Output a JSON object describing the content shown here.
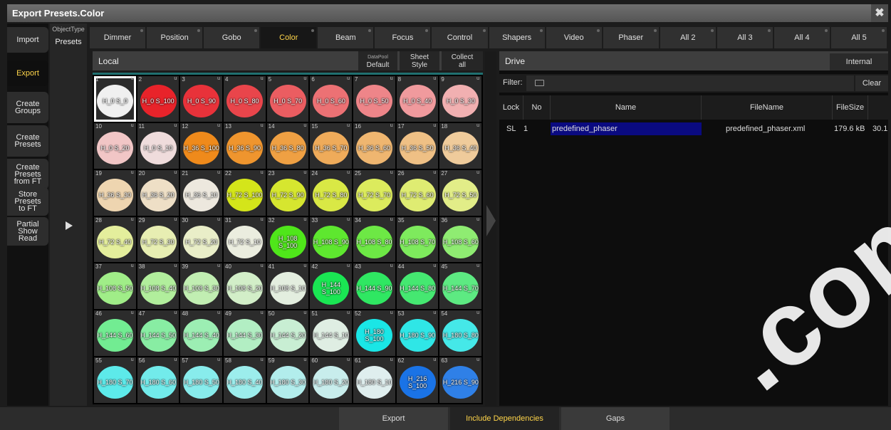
{
  "window": {
    "title": "Export Presets.Color",
    "close_glyph": "✖"
  },
  "left_menu": {
    "items": [
      {
        "label": "Import"
      },
      {
        "label": "Export"
      },
      {
        "label": "Create\nGroups"
      },
      {
        "label": "Create\nPresets"
      },
      {
        "label": "Create\nPresets\nfrom FT"
      },
      {
        "label": "Store\nPresets\nto FT"
      },
      {
        "label": "Partial\nShow\nRead"
      }
    ]
  },
  "object_type": {
    "label": "ObjectType",
    "value": "Presets"
  },
  "tabs": [
    "Dimmer",
    "Position",
    "Gobo",
    "Color",
    "Beam",
    "Focus",
    "Control",
    "Shapers",
    "Video",
    "Phaser",
    "All 2",
    "All 3",
    "All 4",
    "All 5"
  ],
  "local": {
    "title": "Local",
    "datapool_label": "DataPool",
    "datapool_value": "Default",
    "sheet_style": "Sheet\nStyle",
    "collect_all": "Collect\nall"
  },
  "presets": [
    {
      "n": "1",
      "name": "H_0 S_0",
      "color": "#f0f0f0"
    },
    {
      "n": "2",
      "name": "H_0 S_100",
      "color": "#e8232a"
    },
    {
      "n": "3",
      "name": "H_0 S_90",
      "color": "#e8323a"
    },
    {
      "n": "4",
      "name": "H_0 S_80",
      "color": "#e9454b"
    },
    {
      "n": "5",
      "name": "H_0 S_70",
      "color": "#eb5d61"
    },
    {
      "n": "6",
      "name": "H_0 S_60",
      "color": "#ec7174"
    },
    {
      "n": "7",
      "name": "H_0 S_50",
      "color": "#ee8589"
    },
    {
      "n": "8",
      "name": "H_0 S_40",
      "color": "#f09a9d"
    },
    {
      "n": "9",
      "name": "H_0 S_30",
      "color": "#f1b0b1"
    },
    {
      "n": "10",
      "name": "H_0 S_20",
      "color": "#f1c6c6"
    },
    {
      "n": "11",
      "name": "H_0 S_10",
      "color": "#efdcdc"
    },
    {
      "n": "12",
      "name": "H_36 S_100",
      "color": "#ef8a1b"
    },
    {
      "n": "13",
      "name": "H_36 S_90",
      "color": "#ef952e"
    },
    {
      "n": "14",
      "name": "H_36 S_80",
      "color": "#efa043"
    },
    {
      "n": "15",
      "name": "H_36 S_70",
      "color": "#efab5a"
    },
    {
      "n": "16",
      "name": "H_36 S_60",
      "color": "#efb670"
    },
    {
      "n": "17",
      "name": "H_36 S_50",
      "color": "#efc085"
    },
    {
      "n": "18",
      "name": "H_36 S_40",
      "color": "#efcb9b"
    },
    {
      "n": "19",
      "name": "H_36 S_30",
      "color": "#eed5b0"
    },
    {
      "n": "20",
      "name": "H_36 S_20",
      "color": "#eedfc6"
    },
    {
      "n": "21",
      "name": "H_36 S_10",
      "color": "#ede8de"
    },
    {
      "n": "22",
      "name": "H_72 S_100",
      "color": "#d4e51a"
    },
    {
      "n": "23",
      "name": "H_72 S_90",
      "color": "#d6e62f"
    },
    {
      "n": "24",
      "name": "H_72 S_80",
      "color": "#d9e845"
    },
    {
      "n": "25",
      "name": "H_72 S_70",
      "color": "#dceb5d"
    },
    {
      "n": "26",
      "name": "H_72 S_60",
      "color": "#dfec72"
    },
    {
      "n": "27",
      "name": "H_72 S_50",
      "color": "#e2ed88"
    },
    {
      "n": "28",
      "name": "H_72 S_40",
      "color": "#e4ee9c"
    },
    {
      "n": "29",
      "name": "H_72 S_30",
      "color": "#e7eeb2"
    },
    {
      "n": "30",
      "name": "H_72 S_20",
      "color": "#e9eec8"
    },
    {
      "n": "31",
      "name": "H_72 S_10",
      "color": "#ebeddf"
    },
    {
      "n": "32",
      "name": "H_108\nS_100",
      "color": "#4fe61a"
    },
    {
      "n": "33",
      "name": "H_108 S_90",
      "color": "#5ee72f"
    },
    {
      "n": "34",
      "name": "H_108 S_80",
      "color": "#6de845"
    },
    {
      "n": "35",
      "name": "H_108 S_70",
      "color": "#7eea5d"
    },
    {
      "n": "36",
      "name": "H_108 S_60",
      "color": "#8fec72"
    },
    {
      "n": "37",
      "name": "H_108 S_50",
      "color": "#a0ed88"
    },
    {
      "n": "38",
      "name": "H_108 S_40",
      "color": "#b1ee9c"
    },
    {
      "n": "39",
      "name": "H_108 S_30",
      "color": "#c1eeb2"
    },
    {
      "n": "40",
      "name": "H_108 S_20",
      "color": "#d2eec8"
    },
    {
      "n": "41",
      "name": "H_108 S_10",
      "color": "#e3eedf"
    },
    {
      "n": "42",
      "name": "H_144\nS_100",
      "color": "#1ae653"
    },
    {
      "n": "43",
      "name": "H_144 S_90",
      "color": "#2fe762"
    },
    {
      "n": "44",
      "name": "H_144 S_80",
      "color": "#45e871"
    },
    {
      "n": "45",
      "name": "H_144 S_70",
      "color": "#5dea82"
    },
    {
      "n": "46",
      "name": "H_144 S_60",
      "color": "#72ec92"
    },
    {
      "n": "47",
      "name": "H_144 S_50",
      "color": "#88eda3"
    },
    {
      "n": "48",
      "name": "H_144 S_40",
      "color": "#9ceeb3"
    },
    {
      "n": "49",
      "name": "H_144 S_30",
      "color": "#b2eec3"
    },
    {
      "n": "50",
      "name": "H_144 S_20",
      "color": "#c8eed3"
    },
    {
      "n": "51",
      "name": "H_144 S_10",
      "color": "#dfeee3"
    },
    {
      "n": "52",
      "name": "H_180\nS_100",
      "color": "#1ae6e6"
    },
    {
      "n": "53",
      "name": "H_180 S_90",
      "color": "#2fe6e6"
    },
    {
      "n": "54",
      "name": "H_180 S_80",
      "color": "#45e8e8"
    },
    {
      "n": "55",
      "name": "H_180 S_70",
      "color": "#5deaea"
    },
    {
      "n": "56",
      "name": "H_180 S_60",
      "color": "#72ebeb"
    },
    {
      "n": "57",
      "name": "H_180 S_50",
      "color": "#88ecec"
    },
    {
      "n": "58",
      "name": "H_180 S_40",
      "color": "#9cedec"
    },
    {
      "n": "59",
      "name": "H_180 S_30",
      "color": "#b2edec"
    },
    {
      "n": "60",
      "name": "H_180 S_20",
      "color": "#c8edec"
    },
    {
      "n": "61",
      "name": "H_180 S_10",
      "color": "#dfeeee"
    },
    {
      "n": "62",
      "name": "H_216\nS_100",
      "color": "#1a73e6"
    },
    {
      "n": "63",
      "name": "H_216 S_90",
      "color": "#2f80e7"
    }
  ],
  "drive": {
    "title": "Drive",
    "internal": "Internal",
    "filter_label": "Filter:",
    "clear": "Clear",
    "columns": {
      "lock": "Lock",
      "no": "No",
      "name": "Name",
      "filename": "FileName",
      "filesize": "FileSize"
    },
    "rows": [
      {
        "lock": "SL",
        "no": "1",
        "name": "predefined_phaser",
        "filename": "predefined_phaser.xml",
        "filesize": "179.6 kB",
        "extra": "30.1"
      }
    ]
  },
  "bottom": {
    "export": "Export",
    "include_dependencies": "Include Dependencies",
    "gaps": "Gaps"
  },
  "watermark": ".com"
}
